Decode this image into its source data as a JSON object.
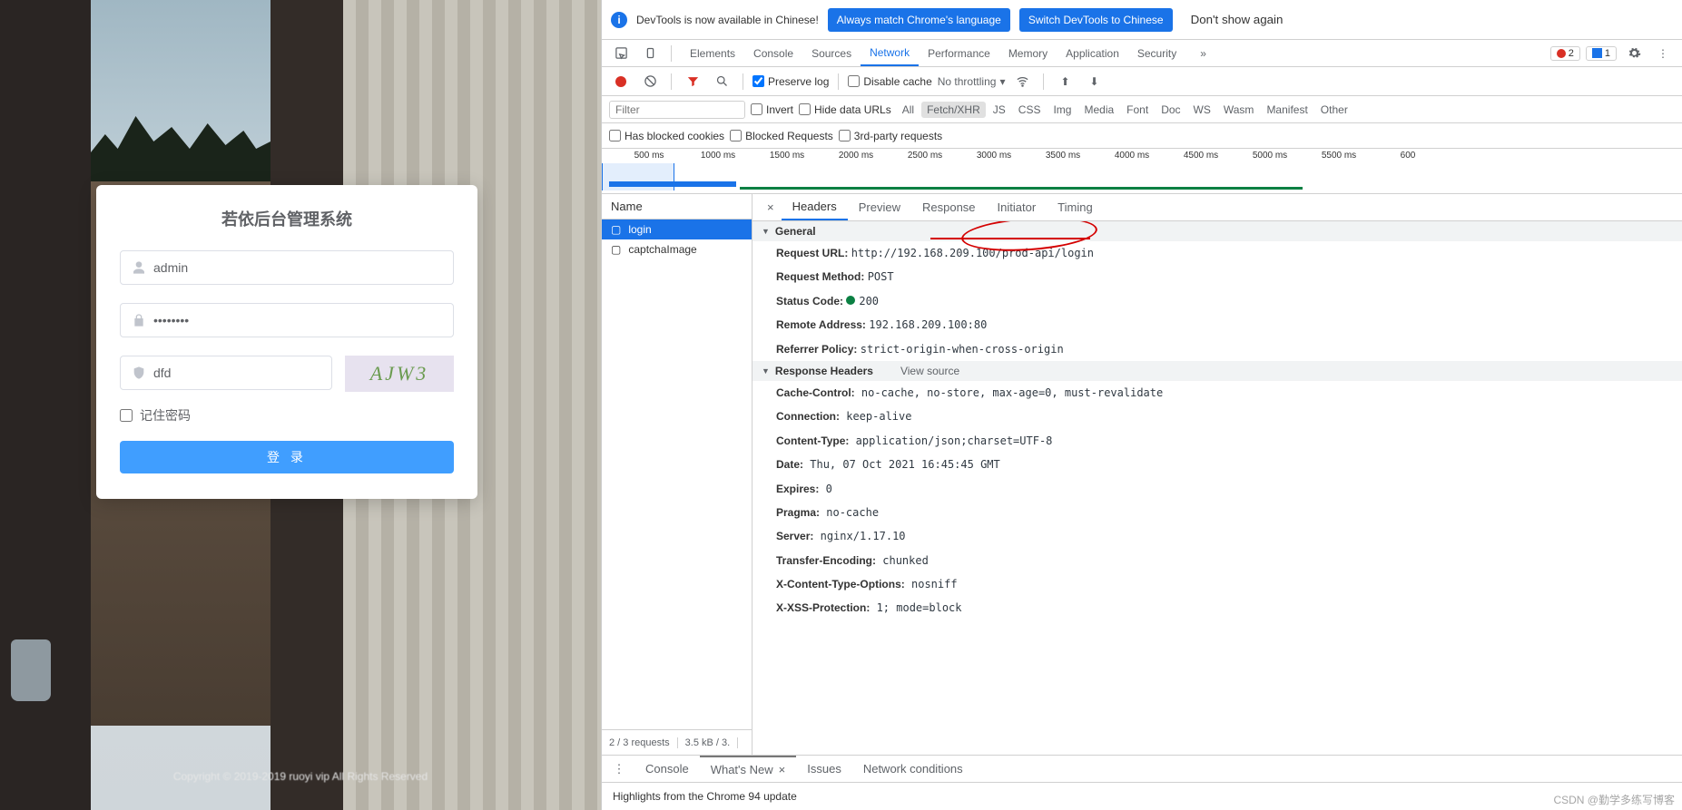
{
  "login": {
    "title": "若依后台管理系统",
    "username": "admin",
    "password": "••••••••",
    "captcha": "dfd",
    "captchaImage": "AJW3",
    "remember": "记住密码",
    "button": "登 录",
    "copyright": "Copyright © 2019-2019 ruoyi vip All Rights Reserved"
  },
  "notice": {
    "text": "DevTools is now available in Chinese!",
    "btn1": "Always match Chrome's language",
    "btn2": "Switch DevTools to Chinese",
    "btn3": "Don't show again"
  },
  "topTabs": [
    "Elements",
    "Console",
    "Sources",
    "Network",
    "Performance",
    "Memory",
    "Application",
    "Security"
  ],
  "topActive": "Network",
  "errors": "2",
  "issues": "1",
  "ctrl": {
    "preserve": "Preserve log",
    "disableCache": "Disable cache",
    "throttle": "No throttling"
  },
  "filter": {
    "placeholder": "Filter",
    "invert": "Invert",
    "hideData": "Hide data URLs",
    "types": [
      "All",
      "Fetch/XHR",
      "JS",
      "CSS",
      "Img",
      "Media",
      "Font",
      "Doc",
      "WS",
      "Wasm",
      "Manifest",
      "Other"
    ],
    "selected": "Fetch/XHR",
    "blocked": "Has blocked cookies",
    "blockedReq": "Blocked Requests",
    "thirdParty": "3rd-party requests"
  },
  "timeline": [
    "500 ms",
    "1000 ms",
    "1500 ms",
    "2000 ms",
    "2500 ms",
    "3000 ms",
    "3500 ms",
    "4000 ms",
    "4500 ms",
    "5000 ms",
    "5500 ms",
    "600"
  ],
  "requests": {
    "header": "Name",
    "rows": [
      "login",
      "captchaImage"
    ],
    "selected": "login",
    "footer1": "2 / 3 requests",
    "footer2": "3.5 kB / 3."
  },
  "detailTabs": [
    "Headers",
    "Preview",
    "Response",
    "Initiator",
    "Timing"
  ],
  "detailActive": "Headers",
  "general": {
    "title": "General",
    "url_k": "Request URL:",
    "url_v": "http://192.168.209.100/prod-api/login",
    "method_k": "Request Method:",
    "method_v": "POST",
    "status_k": "Status Code:",
    "status_v": "200",
    "remote_k": "Remote Address:",
    "remote_v": "192.168.209.100:80",
    "ref_k": "Referrer Policy:",
    "ref_v": "strict-origin-when-cross-origin"
  },
  "resp": {
    "title": "Response Headers",
    "viewSource": "View source",
    "rows": [
      [
        "Cache-Control:",
        "no-cache, no-store, max-age=0, must-revalidate"
      ],
      [
        "Connection:",
        "keep-alive"
      ],
      [
        "Content-Type:",
        "application/json;charset=UTF-8"
      ],
      [
        "Date:",
        "Thu, 07 Oct 2021 16:45:45 GMT"
      ],
      [
        "Expires:",
        "0"
      ],
      [
        "Pragma:",
        "no-cache"
      ],
      [
        "Server:",
        "nginx/1.17.10"
      ],
      [
        "Transfer-Encoding:",
        "chunked"
      ],
      [
        "X-Content-Type-Options:",
        "nosniff"
      ],
      [
        "X-XSS-Protection:",
        "1; mode=block"
      ]
    ]
  },
  "drawerTabs": [
    "Console",
    "What's New",
    "Issues",
    "Network conditions"
  ],
  "drawerActive": "What's New",
  "drawerBody": "Highlights from the Chrome 94 update",
  "watermark": "CSDN @勤学多练写博客"
}
